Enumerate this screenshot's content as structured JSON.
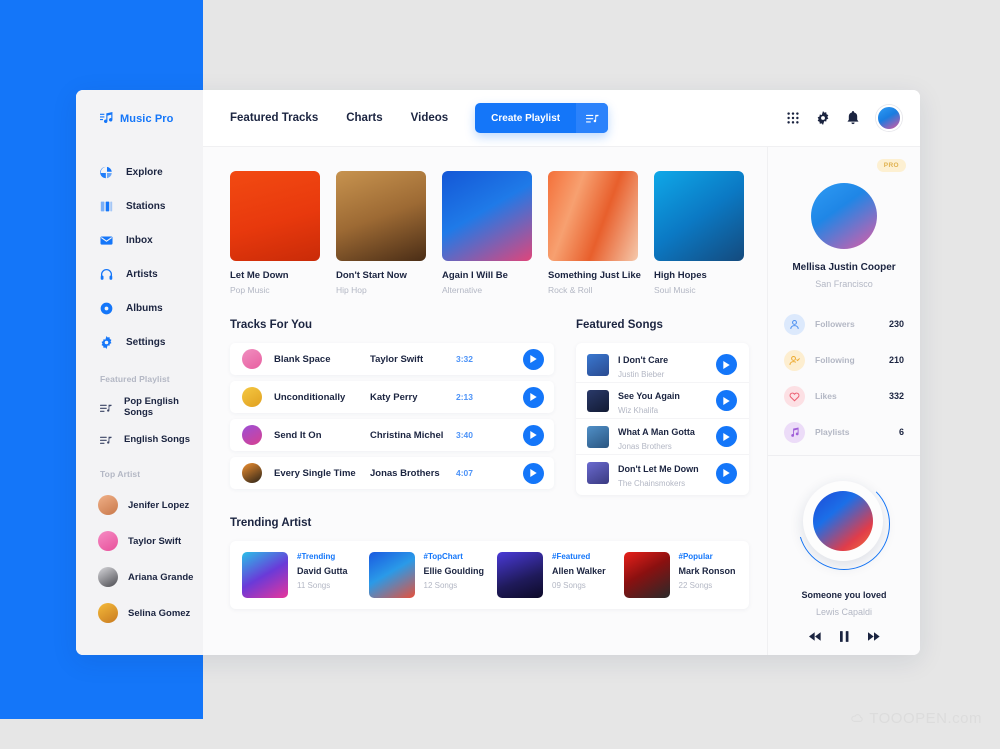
{
  "brand": {
    "name": "Music Pro",
    "logo_icon": "music-note-list-icon"
  },
  "sidebar": {
    "nav": [
      {
        "label": "Explore",
        "icon": "explore-pie-icon"
      },
      {
        "label": "Stations",
        "icon": "stations-bars-icon"
      },
      {
        "label": "Inbox",
        "icon": "inbox-envelope-icon"
      },
      {
        "label": "Artists",
        "icon": "headphones-icon"
      },
      {
        "label": "Albums",
        "icon": "disc-icon"
      },
      {
        "label": "Settings",
        "icon": "gear-icon"
      }
    ],
    "featured_playlist_title": "Featured Playlist",
    "playlists": [
      {
        "label": "Pop English Songs"
      },
      {
        "label": "English Songs"
      }
    ],
    "top_artist_title": "Top Artist",
    "artists": [
      {
        "name": "Jenifer Lopez",
        "avatar_color": "#e8a87c"
      },
      {
        "name": "Taylor Swift",
        "avatar_color": "#f06fae"
      },
      {
        "name": "Ariana Grande",
        "avatar_color": "#8e9097"
      },
      {
        "name": "Selina Gomez",
        "avatar_color": "#f0a830"
      }
    ]
  },
  "topbar": {
    "tabs": [
      {
        "label": "Featured Tracks"
      },
      {
        "label": "Charts"
      },
      {
        "label": "Videos"
      }
    ],
    "cta_label": "Create Playlist",
    "cta_icon": "playlist-add-icon",
    "icons": [
      {
        "name": "apps-grid-icon"
      },
      {
        "name": "gear-icon"
      },
      {
        "name": "bell-icon"
      }
    ],
    "avatar_name": "user-avatar"
  },
  "featured_cards": [
    {
      "title": "Let Me Down",
      "genre": "Pop Music",
      "art": "linear-gradient(165deg,#f24a12 0%,#e8390d 55%,#c92b08 100%)"
    },
    {
      "title": "Don't Start Now",
      "genre": "Hip Hop",
      "art": "linear-gradient(160deg,#c7934f 0%,#9d6a34 50%,#4a2d16 100%)"
    },
    {
      "title": "Again I Will Be",
      "genre": "Alternative",
      "art": "linear-gradient(150deg,#1457d6 0%,#1f7ae8 45%,#e0457a 100%)"
    },
    {
      "title": "Something Just Like",
      "genre": "Rock & Roll",
      "art": "linear-gradient(110deg,#f4703a 0%,#f7a070 30%,#e85f2c 60%,#f5c9ac 100%)"
    },
    {
      "title": "High Hopes",
      "genre": "Soul Music",
      "art": "linear-gradient(145deg,#0fa8e8 0%,#0b79c4 50%,#144a7d 100%)"
    }
  ],
  "tracks_for_you": {
    "title": "Tracks For You",
    "rows": [
      {
        "title": "Blank Space",
        "artist": "Taylor Swift",
        "time": "3:32",
        "art": "linear-gradient(150deg,#f08fc0 0%,#e85fa0 100%)"
      },
      {
        "title": "Unconditionally",
        "artist": "Katy Perry",
        "time": "2:13",
        "art": "linear-gradient(150deg,#f5c842 0%,#e0a020 100%)"
      },
      {
        "title": "Send It On",
        "artist": "Christina Michel",
        "time": "3:40",
        "art": "linear-gradient(150deg,#9b4fd8 0%,#d8408f 100%)"
      },
      {
        "title": "Every Single Time",
        "artist": "Jonas Brothers",
        "time": "4:07",
        "art": "linear-gradient(150deg,#f09030 0%,#2a2218 100%)"
      }
    ],
    "play_icon": "play-icon"
  },
  "featured_songs": {
    "title": "Featured Songs",
    "rows": [
      {
        "title": "I Don't Care",
        "artist": "Justin Bieber",
        "art": "linear-gradient(150deg,#3a78d0 0%,#2a4a90 100%)"
      },
      {
        "title": "See You Again",
        "artist": "Wiz Khalifa",
        "art": "linear-gradient(150deg,#2a3a6a 0%,#121a33 100%)"
      },
      {
        "title": "What A Man Gotta",
        "artist": "Jonas Brothers",
        "art": "linear-gradient(150deg,#5090c8 0%,#2a5580 100%)"
      },
      {
        "title": "Don't Let Me Down",
        "artist": "The Chainsmokers",
        "art": "linear-gradient(150deg,#6a6ad0 0%,#3a3a80 100%)"
      }
    ],
    "play_icon": "play-icon"
  },
  "trending": {
    "title": "Trending Artist",
    "items": [
      {
        "tag": "#Trending",
        "name": "David Gutta",
        "count": "11 Songs",
        "art": "linear-gradient(150deg,#2ac0e8 0%,#6a3ad8 50%,#e8359a 100%)"
      },
      {
        "tag": "#TopChart",
        "name": "Ellie Goulding",
        "count": "12 Songs",
        "art": "linear-gradient(150deg,#1a5ae0 0%,#2a9ae8 45%,#e8503a 100%)"
      },
      {
        "tag": "#Featured",
        "name": "Allen Walker",
        "count": "09 Songs",
        "art": "linear-gradient(160deg,#4a3ad8 0%,#1f1a5a 60%,#0d0a28 100%)"
      },
      {
        "tag": "#Popular",
        "name": "Mark Ronson",
        "count": "22 Songs",
        "art": "linear-gradient(150deg,#e8201a 0%,#8a1010 45%,#2a2a2a 100%)"
      }
    ]
  },
  "profile": {
    "pro_badge": "PRO",
    "name": "Mellisa Justin Cooper",
    "location": "San Francisco",
    "stats": [
      {
        "label": "Followers",
        "value": "230",
        "icon": "person-icon",
        "bg": "#dce9fc",
        "color": "#4a8ff0"
      },
      {
        "label": "Following",
        "value": "210",
        "icon": "person-check-icon",
        "bg": "#fdeed0",
        "color": "#edab32"
      },
      {
        "label": "Likes",
        "value": "332",
        "icon": "heart-icon",
        "bg": "#fce0e4",
        "color": "#ec5f72"
      },
      {
        "label": "Playlists",
        "value": "6",
        "icon": "music-note-icon",
        "bg": "#ecdcf8",
        "color": "#a05fd8"
      }
    ]
  },
  "now_playing": {
    "title": "Someone you loved",
    "artist": "Lewis Capaldi",
    "controls": [
      {
        "name": "previous-icon"
      },
      {
        "name": "pause-icon"
      },
      {
        "name": "next-icon"
      }
    ]
  },
  "watermark": {
    "text": "TOOOPEN.com"
  },
  "colors": {
    "brand_blue": "#1476f9",
    "text_dark": "#1b2440",
    "text_muted": "#b3b7c4",
    "panel_bg": "#fbfbfc",
    "sidebar_bg": "#f3f3f5",
    "page_bg": "#e6e6e6"
  }
}
